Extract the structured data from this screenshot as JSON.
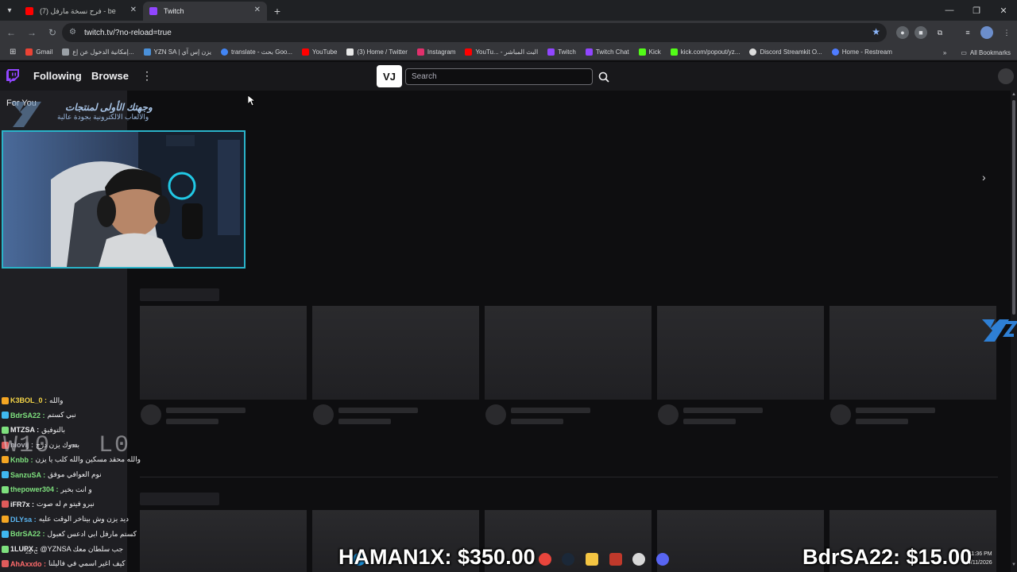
{
  "browser": {
    "tabs": [
      {
        "label": "(7) فرح نسخة مارفل - be",
        "active": false,
        "favicon_color": "#ff0000"
      },
      {
        "label": "Twitch",
        "active": true,
        "favicon_color": "#9146ff"
      }
    ],
    "url": "twitch.tv/?no-reload=true",
    "bookmarks": [
      {
        "label": "Gmail",
        "color": "#ea4335"
      },
      {
        "label": "إمكانية الدخول عن إع...",
        "color": "#9aa0a6"
      },
      {
        "label": "YZN SA | يزن إس آي",
        "color": "#4a90d9"
      },
      {
        "label": "translate - بحث Goo...",
        "color": "#4285f4"
      },
      {
        "label": "YouTube",
        "color": "#ff0000"
      },
      {
        "label": "(3) Home / Twitter",
        "color": "#e8e8e8"
      },
      {
        "label": "Instagram",
        "color": "#e1306c"
      },
      {
        "label": "YouTu... - البث المباشر",
        "color": "#ff0000"
      },
      {
        "label": "Twitch",
        "color": "#9146ff"
      },
      {
        "label": "Twitch Chat",
        "color": "#9146ff"
      },
      {
        "label": "Kick",
        "color": "#53fc18"
      },
      {
        "label": "kick.com/popout/yz...",
        "color": "#53fc18"
      },
      {
        "label": "Discord Streamkit O...",
        "color": "#dcdcdc"
      },
      {
        "label": "Home - Restream",
        "color": "#4f7cff"
      }
    ],
    "all_bookmarks": "All Bookmarks"
  },
  "twitch": {
    "nav_following": "Following",
    "nav_browse": "Browse",
    "search_placeholder": "Search",
    "vj_label": "VJ",
    "sidebar_heading": "For You"
  },
  "overlay": {
    "promo_line1": "وجهتك الأولى لمنتجات",
    "promo_line2": "والألعاب الالكترونية بجودة عالية",
    "wl_record": "W10 - L0",
    "donation_left": "HAMAN1X: $350.00",
    "donation_right": "BdrSA22: $15.00",
    "time": "11:36 PM",
    "date": "4/11/2026",
    "temp": "25°C",
    "chat": [
      {
        "name": "K3BOL_0",
        "msg": "والله",
        "color": "#f5d547"
      },
      {
        "name": "BdrSA22",
        "msg": "نبي كستم",
        "color": "#7ee07e"
      },
      {
        "name": "MTZSA",
        "msg": "بالتوفيق",
        "color": "#efeff1"
      },
      {
        "name": "niovij",
        "msg": "بندوك يزن درج",
        "color": "#b0b0b8"
      },
      {
        "name": "Knbb",
        "msg": "والله محقد مسكين والله كلب يا يزن",
        "color": "#7ee07e"
      },
      {
        "name": "SanzuSA",
        "msg": "نوم العوافي موفق",
        "color": "#7ee07e"
      },
      {
        "name": "thepower304",
        "msg": "و انت بخير",
        "color": "#7ee07e"
      },
      {
        "name": "iFR7x",
        "msg": "نيرو فيتو م له صوت",
        "color": "#efeff1"
      },
      {
        "name": "DLYsa",
        "msg": "ديد يزن وش بيتاخر الوقت عليه",
        "color": "#5ab4f0"
      },
      {
        "name": "BdrSA22",
        "msg": "كستم مارفل ابي ادعس كعبول",
        "color": "#7ee07e"
      },
      {
        "name": "1LUPX",
        "msg": "@YZNSA جب سلطان معك",
        "color": "#efeff1"
      },
      {
        "name": "AhAxxdo",
        "msg": "كيف اغير اسمي في فاليلنا",
        "color": "#ff6b6b"
      }
    ]
  }
}
